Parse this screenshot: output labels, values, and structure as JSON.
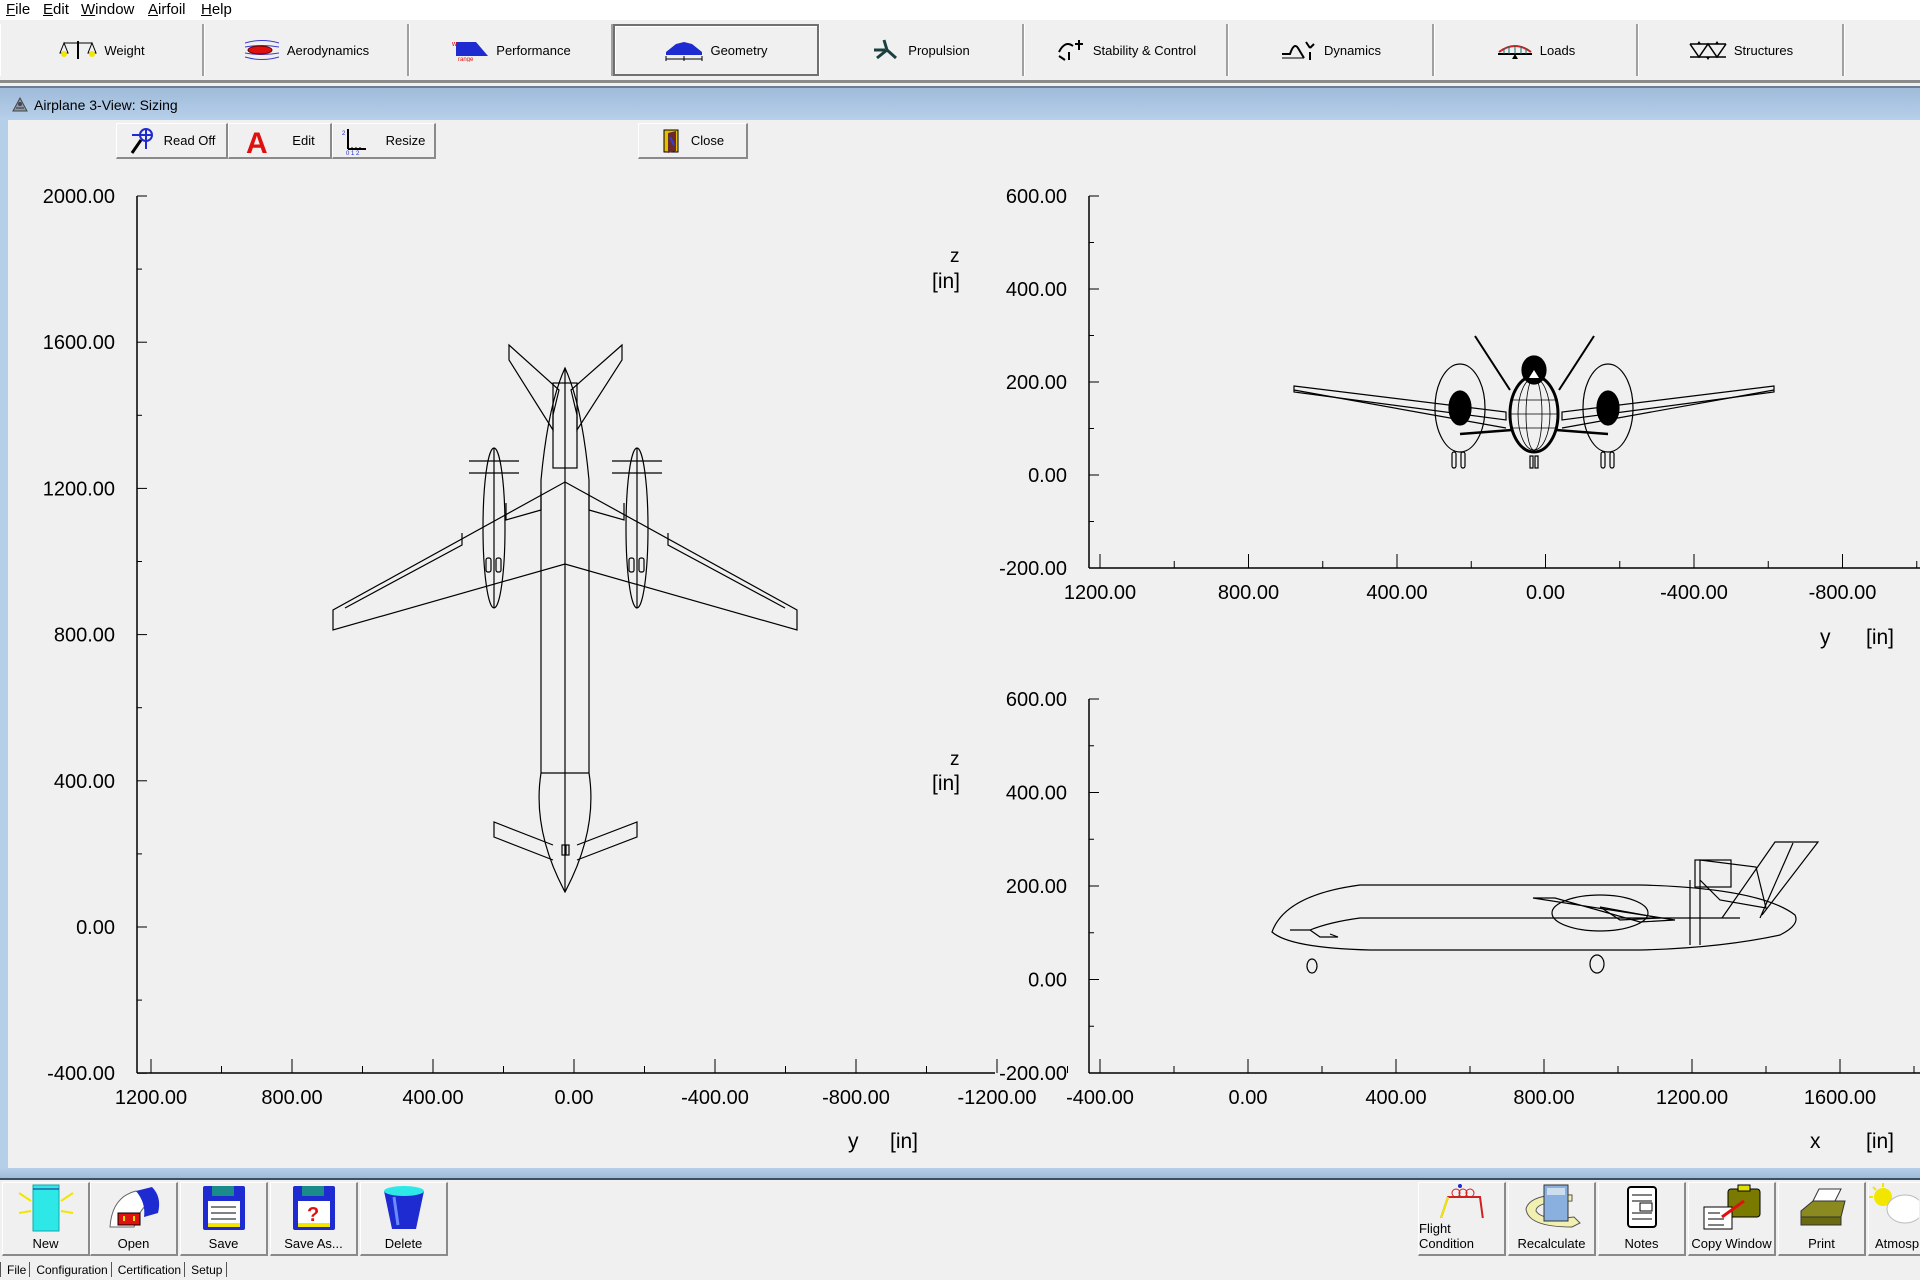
{
  "menu": [
    "File",
    "Edit",
    "Window",
    "Airfoil",
    "Help"
  ],
  "modules": [
    {
      "label": "Weight",
      "icon": "balance-scale-icon"
    },
    {
      "label": "Aerodynamics",
      "icon": "airflow-icon"
    },
    {
      "label": "Performance",
      "icon": "performance-range-icon"
    },
    {
      "label": "Geometry",
      "icon": "geometry-wing-icon",
      "active": true
    },
    {
      "label": "Propulsion",
      "icon": "propeller-icon"
    },
    {
      "label": "Stability & Control",
      "icon": "stability-icon"
    },
    {
      "label": "Dynamics",
      "icon": "dynamics-icon"
    },
    {
      "label": "Loads",
      "icon": "loads-icon"
    },
    {
      "label": "Structures",
      "icon": "truss-icon"
    }
  ],
  "window": {
    "title": "Airplane 3-View: Sizing"
  },
  "subtoolbar": {
    "read_off": "Read Off",
    "edit": "Edit",
    "resize": "Resize",
    "close": "Close"
  },
  "bottom_left": [
    {
      "label": "New",
      "icon": "new-file-icon"
    },
    {
      "label": "Open",
      "icon": "open-hangar-icon"
    },
    {
      "label": "Save",
      "icon": "floppy-save-icon"
    },
    {
      "label": "Save As...",
      "icon": "floppy-saveas-icon"
    },
    {
      "label": "Delete",
      "icon": "trash-bin-icon"
    }
  ],
  "bottom_right": [
    {
      "label": "Flight Condition",
      "icon": "flight-condition-icon"
    },
    {
      "label": "Recalculate",
      "icon": "calculator-icon"
    },
    {
      "label": "Notes",
      "icon": "notepad-icon"
    },
    {
      "label": "Copy Window",
      "icon": "copy-window-icon"
    },
    {
      "label": "Print",
      "icon": "printer-icon"
    },
    {
      "label": "Atmosp",
      "icon": "weather-icon"
    }
  ],
  "tabs": [
    "File",
    "Configuration",
    "Certification",
    "Setup"
  ],
  "chart_data": [
    {
      "type": "diagram-plot",
      "view": "top",
      "xlabel": "y",
      "xunit": "[in]",
      "ylabel": "",
      "yunit": "",
      "xlim": [
        1200,
        -1200
      ],
      "ylim": [
        -400,
        2000
      ],
      "xticks": [
        "1200.00",
        "800.00",
        "400.00",
        "0.00",
        "-400.00",
        "-800.00",
        "-1200.00"
      ],
      "yticks": [
        "2000.00",
        "1600.00",
        "1200.00",
        "800.00",
        "400.00",
        "0.00",
        "-400.00"
      ]
    },
    {
      "type": "diagram-plot",
      "view": "front",
      "xlabel": "y",
      "xunit": "[in]",
      "ylabel": "z",
      "yunit": "[in]",
      "xlim": [
        1200,
        -1000
      ],
      "ylim": [
        -200,
        600
      ],
      "xticks": [
        "1200.00",
        "800.00",
        "400.00",
        "0.00",
        "-400.00",
        "-800.00"
      ],
      "yticks": [
        "600.00",
        "400.00",
        "200.00",
        "0.00",
        "-200.00"
      ]
    },
    {
      "type": "diagram-plot",
      "view": "side",
      "xlabel": "x",
      "xunit": "[in]",
      "ylabel": "z",
      "yunit": "[in]",
      "xlim": [
        -400,
        1800
      ],
      "ylim": [
        -200,
        600
      ],
      "xticks": [
        "-400.00",
        "0.00",
        "400.00",
        "800.00",
        "1200.00",
        "1600.00"
      ],
      "yticks": [
        "600.00",
        "400.00",
        "200.00",
        "0.00",
        "-200.00"
      ]
    }
  ]
}
